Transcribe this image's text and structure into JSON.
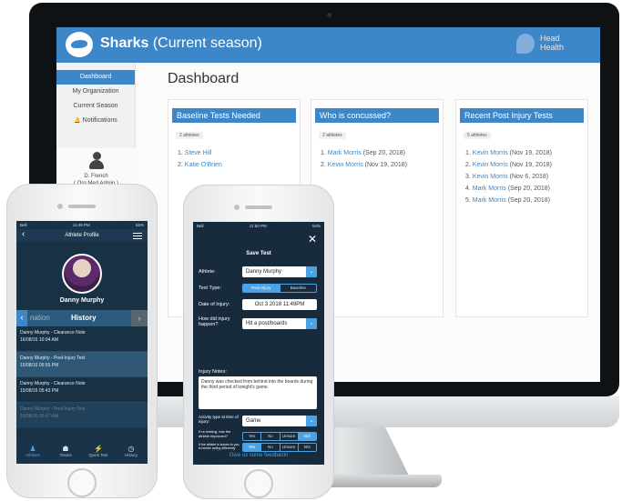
{
  "desktop": {
    "team_name": "Sharks",
    "season_label": "(Current season)",
    "brand": "Head Health",
    "sidebar": {
      "items": [
        "Dashboard",
        "My Organization",
        "Current Season",
        "Notifications"
      ],
      "user_name": "D. French",
      "user_role": "( Org Med Admin )"
    },
    "page_title": "Dashboard",
    "cards": [
      {
        "title": "Baseline Tests Needed",
        "count": "2 athletes",
        "items": [
          {
            "num": "1.",
            "name": "Steve Hill",
            "date": ""
          },
          {
            "num": "2.",
            "name": "Katie O'Brien",
            "date": ""
          }
        ]
      },
      {
        "title": "Who is concussed?",
        "count": "2 athletes",
        "items": [
          {
            "num": "1.",
            "name": "Mark Morris",
            "date": "(Sep 20, 2018)"
          },
          {
            "num": "2.",
            "name": "Kevin Morris",
            "date": "(Nov 19, 2018)"
          }
        ]
      },
      {
        "title": "Recent Post Injury Tests",
        "count": "5 athletes",
        "items": [
          {
            "num": "1.",
            "name": "Kevin Morris",
            "date": "(Nov 19, 2018)"
          },
          {
            "num": "2.",
            "name": "Kevin Morris",
            "date": "(Nov 19, 2018)"
          },
          {
            "num": "3.",
            "name": "Kevin Morris",
            "date": "(Nov 6, 2018)"
          },
          {
            "num": "4.",
            "name": "Mark Morris",
            "date": "(Sep 20, 2018)"
          },
          {
            "num": "5.",
            "name": "Mark Morris",
            "date": "(Sep 20, 2018)"
          }
        ]
      }
    ]
  },
  "phone1": {
    "status_left": "Bell",
    "status_time": "11:45 PM",
    "status_right": "55%",
    "title": "Athlete Profile",
    "athlete_name": "Danny Murphy",
    "tab_prev": "nation",
    "tab_active": "History",
    "history": [
      {
        "title": "Danny Murphy - Clearance Note",
        "date": "16/08/16 10:04 AM"
      },
      {
        "title": "Danny Murphy - Post-Injury Test",
        "date": "15/08/16 05:55 PM"
      },
      {
        "title": "Danny Murphy - Clearance Note",
        "date": "15/08/16 05:43 PM"
      },
      {
        "title": "Danny Murphy - Post-Injury Test",
        "date": "15/08/16 05:47 AM"
      }
    ],
    "tabbar": [
      "Athletes",
      "Teams",
      "Quick Test",
      "History"
    ]
  },
  "phone2": {
    "status_left": "Bell",
    "status_time": "11:50 PM",
    "status_right": "54%",
    "title": "Save Test",
    "athlete_label": "Athlete:",
    "athlete_value": "Danny Murphy",
    "test_type_label": "Test Type:",
    "test_types": [
      "Post-Injury",
      "Baseline"
    ],
    "injury_date_label": "Date of Injury:",
    "injury_date_value": "Oct 3 2018 11:49PM",
    "how_label": "How did injury happen?",
    "how_value": "Hit a post/boards",
    "notes_label": "Injury Notes:",
    "notes_value": "Danny was checked from behind into the boards during the third period of tonight's game.",
    "activity_label": "Activity type at time of injury:",
    "activity_value": "Game",
    "retest_label": "If re-testing, has the athlete improved?",
    "behav_label": "If the athlete is known to you, is he/she acting differently compared to their normal self?",
    "options": [
      "Yes",
      "No",
      "Unsure",
      "N/A"
    ],
    "feedback": "Give us some feedback!"
  }
}
